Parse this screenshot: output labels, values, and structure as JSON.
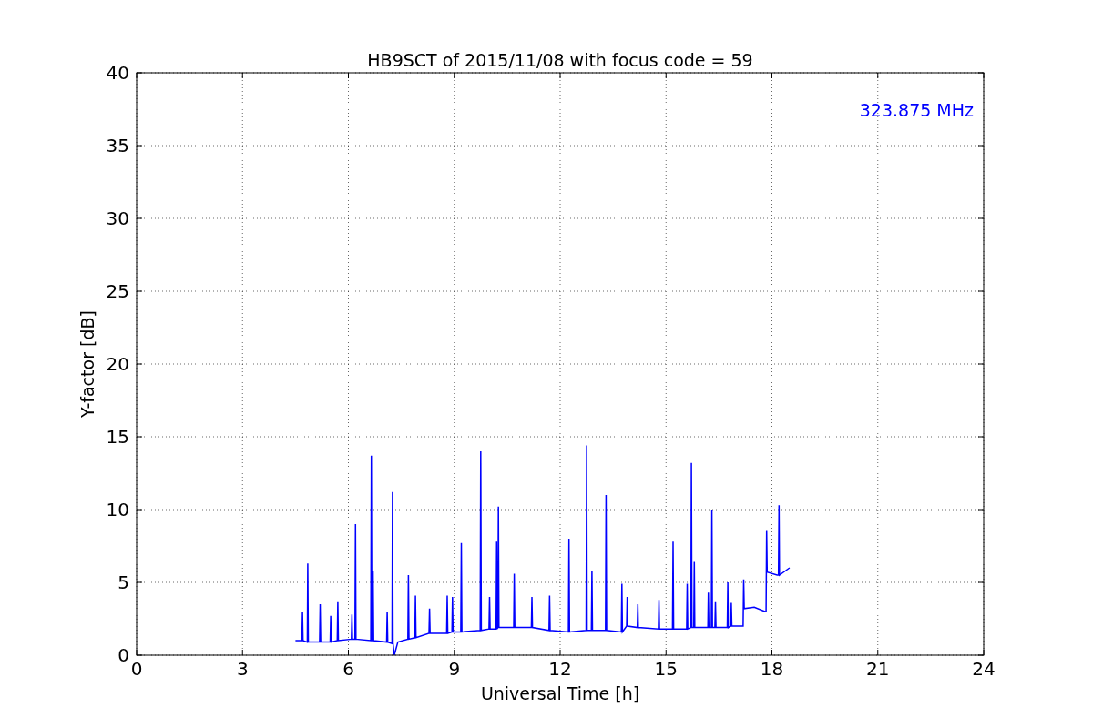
{
  "chart_data": {
    "type": "line",
    "title": "HB9SCT of 2015/11/08 with focus code = 59",
    "xlabel": "Universal Time [h]",
    "ylabel": "Y-factor [dB]",
    "x": [
      4.5,
      4.685,
      4.7,
      4.715,
      4.835,
      4.85,
      4.865,
      5.185,
      5.2,
      5.215,
      5.485,
      5.5,
      5.515,
      5.685,
      5.7,
      5.715,
      6.085,
      6.1,
      6.115,
      6.185,
      6.2,
      6.215,
      6.635,
      6.65,
      6.665,
      6.685,
      6.7,
      6.715,
      7.085,
      7.1,
      7.115,
      7.235,
      7.25,
      7.265,
      7.3,
      7.4,
      7.685,
      7.7,
      7.715,
      7.885,
      7.9,
      7.915,
      8.285,
      8.3,
      8.315,
      8.785,
      8.8,
      8.815,
      8.935,
      8.95,
      8.965,
      9.185,
      9.2,
      9.215,
      9.735,
      9.75,
      9.765,
      9.985,
      10.0,
      10.015,
      10.185,
      10.2,
      10.215,
      10.235,
      10.25,
      10.265,
      10.685,
      10.7,
      10.715,
      11.185,
      11.2,
      11.215,
      11.685,
      11.7,
      11.715,
      12.235,
      12.25,
      12.265,
      12.735,
      12.75,
      12.765,
      12.885,
      12.9,
      12.915,
      13.285,
      13.3,
      13.315,
      13.735,
      13.75,
      13.765,
      13.885,
      13.9,
      13.915,
      14.185,
      14.2,
      14.215,
      14.785,
      14.8,
      14.815,
      15.185,
      15.2,
      15.215,
      15.585,
      15.6,
      15.615,
      15.705,
      15.72,
      15.735,
      15.785,
      15.8,
      15.815,
      16.185,
      16.2,
      16.215,
      16.285,
      16.3,
      16.315,
      16.385,
      16.4,
      16.415,
      16.735,
      16.75,
      16.765,
      16.835,
      16.85,
      16.865,
      17.185,
      17.2,
      17.215,
      17.5,
      17.8,
      17.835,
      17.85,
      17.865,
      18.15,
      18.185,
      18.2,
      18.215,
      18.5
    ],
    "series": [
      {
        "name": "323.875 MHz",
        "color": "#0000ff",
        "values": [
          1.0,
          1.0,
          3.0,
          1.0,
          0.9,
          6.3,
          0.9,
          0.9,
          3.5,
          0.9,
          0.9,
          2.7,
          0.9,
          1.0,
          3.7,
          1.0,
          1.1,
          2.8,
          1.1,
          1.1,
          9.0,
          1.1,
          1.0,
          13.7,
          1.0,
          1.0,
          5.8,
          1.0,
          0.9,
          3.0,
          0.9,
          0.8,
          11.2,
          0.8,
          0.0,
          0.9,
          1.1,
          5.5,
          1.1,
          1.2,
          4.1,
          1.2,
          1.5,
          3.2,
          1.5,
          1.5,
          4.1,
          1.5,
          1.6,
          4.0,
          1.6,
          1.6,
          7.7,
          1.6,
          1.7,
          14.0,
          1.7,
          1.8,
          4.0,
          1.8,
          1.8,
          7.8,
          1.8,
          1.9,
          10.2,
          1.9,
          1.9,
          5.6,
          1.9,
          1.9,
          4.0,
          1.9,
          1.7,
          4.1,
          1.7,
          1.6,
          8.0,
          1.6,
          1.7,
          14.4,
          1.7,
          1.7,
          5.8,
          1.7,
          1.7,
          11.0,
          1.7,
          1.6,
          4.9,
          1.6,
          2.0,
          4.0,
          2.0,
          1.9,
          3.5,
          1.9,
          1.8,
          3.8,
          1.8,
          1.8,
          7.8,
          1.8,
          1.8,
          4.9,
          1.8,
          1.9,
          13.2,
          1.9,
          1.9,
          6.4,
          1.9,
          1.9,
          4.3,
          1.9,
          1.9,
          10.0,
          1.9,
          1.9,
          3.7,
          1.9,
          1.9,
          5.0,
          1.9,
          2.0,
          3.6,
          2.0,
          2.0,
          5.2,
          3.2,
          3.3,
          3.0,
          3.0,
          8.6,
          5.7,
          5.5,
          5.5,
          10.3,
          5.5,
          6.0
        ]
      }
    ],
    "xlim": [
      0,
      24
    ],
    "ylim": [
      0,
      40
    ],
    "xticks": [
      0,
      3,
      6,
      9,
      12,
      15,
      18,
      21,
      24
    ],
    "yticks": [
      0,
      5,
      10,
      15,
      20,
      25,
      30,
      35,
      40
    ],
    "grid": true
  }
}
